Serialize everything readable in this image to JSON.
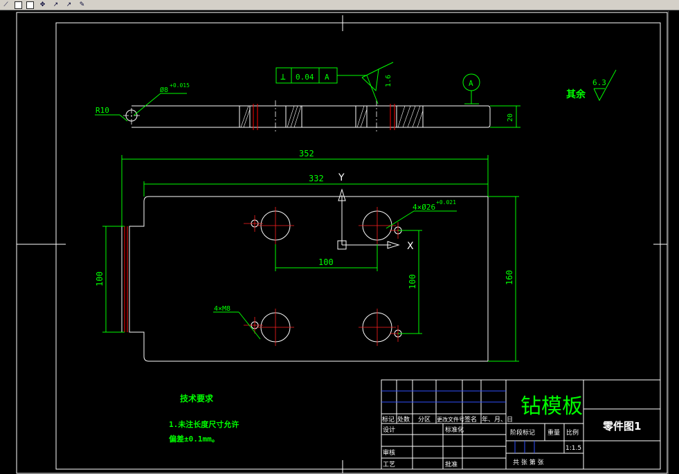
{
  "toolbar": {
    "tools": [
      {
        "icon": "polyline-icon",
        "glyph": "⟋"
      },
      {
        "icon": "rectangle-icon",
        "glyph": ""
      },
      {
        "icon": "rectangle-icon",
        "glyph": ""
      },
      {
        "icon": "move-icon",
        "glyph": "✥"
      },
      {
        "icon": "mirror-icon",
        "glyph": "↗"
      },
      {
        "icon": "trim-icon",
        "glyph": "↗"
      },
      {
        "icon": "fill-icon",
        "glyph": "✎"
      }
    ]
  },
  "drawing": {
    "gdt_flatness": "0.04",
    "gdt_datum": "A",
    "gdt_symbol": "⊥",
    "roughness_value": "1.6",
    "datum_label": "A",
    "other_roughness_label": "其余",
    "other_roughness_value": "6.3",
    "r10": "R10",
    "hole_small": "Ø8",
    "hole_small_tol": "+0.015",
    "thickness": "20",
    "dim_352": "352",
    "dim_332": "332",
    "axis_y": "Y",
    "axis_x": "X",
    "big_holes": "4×Ø26",
    "big_holes_tol": "+0.021",
    "dim_100_h": "100",
    "dim_100_v_left": "100",
    "dim_100_v_right": "100",
    "dim_160": "160",
    "small_holes": "4×M8",
    "tech_title": "技术要求",
    "tech_line1": "1.未注长度尺寸允许",
    "tech_line2": "偏差±0.1mm。"
  },
  "title_block": {
    "part_name": "钻模板",
    "drawing_name": "零件图1",
    "header_labels": [
      "标记",
      "处数",
      "分区",
      "更改文件号",
      "签名",
      "年、月、日"
    ],
    "design": "设计",
    "standard": "标准化",
    "check": "审核",
    "process": "工艺",
    "approve": "批准",
    "stage_mark": "阶段标记",
    "weight": "重量",
    "scale": "比例",
    "scale_value": "1:1.5",
    "sheets": "共  张  第  张"
  },
  "colors": {
    "line": "#ffffff",
    "dim": "#00ff00",
    "center": "#ff2020",
    "hidden": "#ff0000",
    "blue": "#3050ff"
  }
}
